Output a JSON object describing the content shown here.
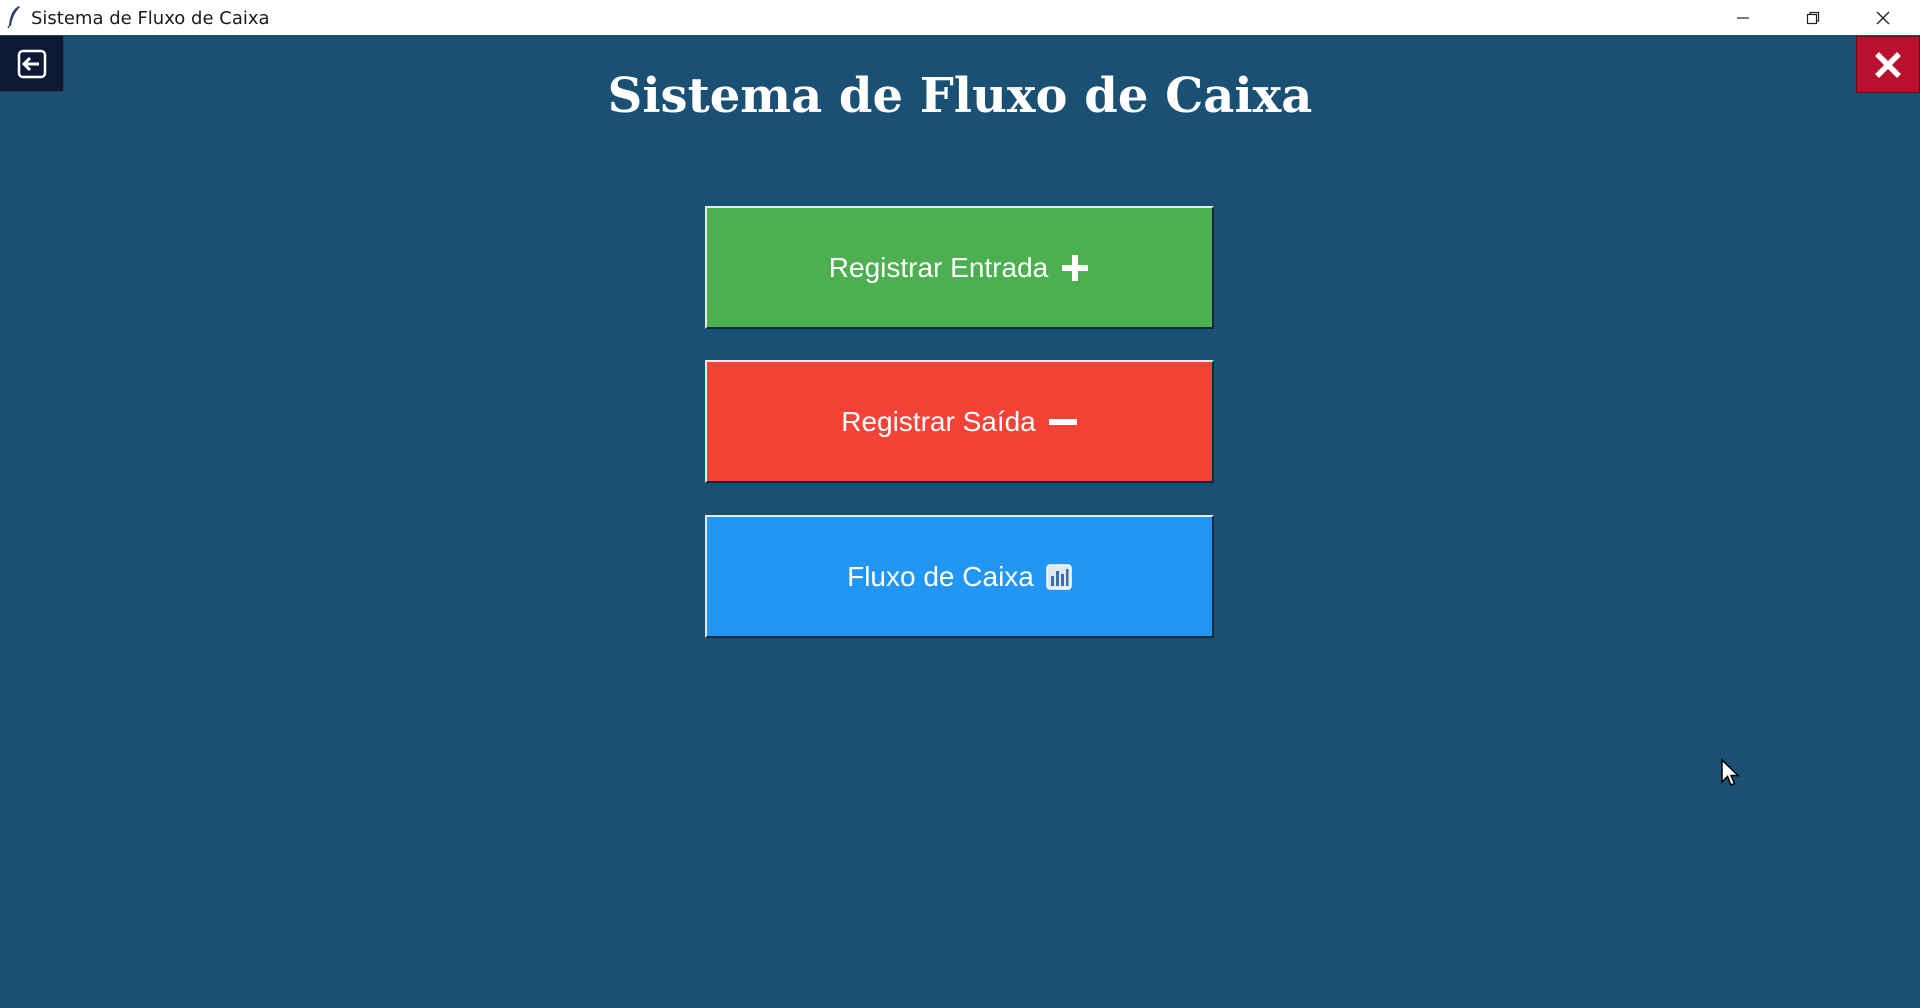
{
  "window": {
    "title": "Sistema de Fluxo de Caixa",
    "icon": "feather-icon"
  },
  "header": {
    "title": "Sistema de Fluxo de Caixa",
    "back_icon": "back-arrow-icon",
    "close_icon": "close-x-icon"
  },
  "menu": {
    "entrada": {
      "label": "Registrar Entrada",
      "icon": "plus-icon",
      "color": "#4caf50"
    },
    "saida": {
      "label": "Registrar Saída",
      "icon": "minus-icon",
      "color": "#f44336"
    },
    "fluxo": {
      "label": "Fluxo de Caixa",
      "icon": "bar-chart-icon",
      "color": "#2196f3"
    }
  },
  "colors": {
    "background": "#1b5075",
    "close_button": "#b8102d",
    "back_button": "#0c1a36"
  }
}
